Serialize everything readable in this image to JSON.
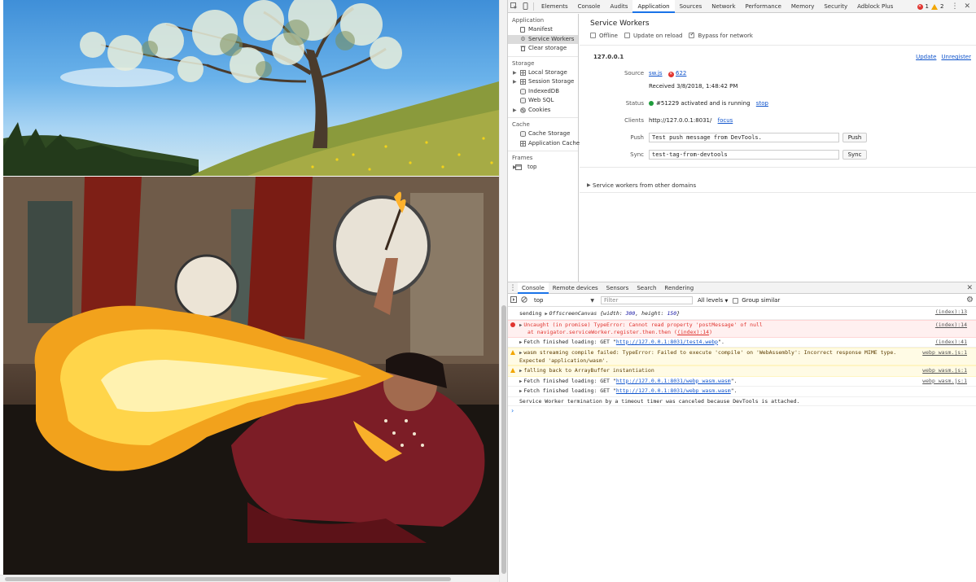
{
  "devtools": {
    "tabs": [
      "Elements",
      "Console",
      "Audits",
      "Application",
      "Sources",
      "Network",
      "Performance",
      "Memory",
      "Security",
      "Adblock Plus"
    ],
    "active_tab": "Application",
    "error_count": "1",
    "warning_count": "2",
    "accent_color": "#1a73e8"
  },
  "sidebar": {
    "application_header": "Application",
    "application_items": [
      "Manifest",
      "Service Workers",
      "Clear storage"
    ],
    "storage_header": "Storage",
    "storage_items": [
      "Local Storage",
      "Session Storage",
      "IndexedDB",
      "Web SQL",
      "Cookies"
    ],
    "cache_header": "Cache",
    "cache_items": [
      "Cache Storage",
      "Application Cache"
    ],
    "frames_header": "Frames",
    "frames_items": [
      "top"
    ]
  },
  "service_workers": {
    "title": "Service Workers",
    "offline_label": "Offline",
    "update_on_reload_label": "Update on reload",
    "bypass_label": "Bypass for network",
    "origin": "127.0.0.1",
    "update_link": "Update",
    "unregister_link": "Unregister",
    "source_label": "Source",
    "source_file": "sw.js",
    "source_errors": "622",
    "received": "Received 3/8/2018, 1:48:42 PM",
    "status_label": "Status",
    "status_text": "#51229 activated and is running",
    "stop_link": "stop",
    "clients_label": "Clients",
    "client_url": "http://127.0.0.1:8031/",
    "focus_link": "focus",
    "push_label": "Push",
    "push_value": "Test push message from DevTools.",
    "push_button": "Push",
    "sync_label": "Sync",
    "sync_value": "test-tag-from-devtools",
    "sync_button": "Sync",
    "other_domains": "Service workers from other domains"
  },
  "drawer": {
    "tabs": [
      "Console",
      "Remote devices",
      "Sensors",
      "Search",
      "Rendering"
    ],
    "active_tab": "Console",
    "context": "top",
    "filter_placeholder": "Filter",
    "levels": "All levels",
    "group_similar": "Group similar"
  },
  "console": {
    "m1_prefix": "sending",
    "m1_obj": "OffscreenCanvas {",
    "m1_width_key": "width: ",
    "m1_width": "300",
    "m1_height_key": ", height: ",
    "m1_height": "150",
    "m1_close": "}",
    "m1_src": "(index):13",
    "m2_line1": "Uncaught (in promise) TypeError: Cannot read property 'postMessage' of null",
    "m2_line2_a": "at navigator.serviceWorker.register.then.then (",
    "m2_line2_link": "(index):14",
    "m2_line2_b": ")",
    "m2_src": "(index):14",
    "m3_prefix": "Fetch finished loading: GET \"",
    "m3_url": "http://127.0.0.1:8031/test4.webp",
    "m3_suffix": "\".",
    "m3_src": "(index):41",
    "m4_line1": "wasm streaming compile failed: TypeError: Failed to execute 'compile' on 'WebAssembly': Incorrect response MIME type.",
    "m4_line2": "Expected 'application/wasm'.",
    "m4_src": "webp_wasm.js:1",
    "m5_text": "falling back to ArrayBuffer instantiation",
    "m5_src": "webp_wasm.js:1",
    "m6_prefix": "Fetch finished loading: GET \"",
    "m6_url": "http://127.0.0.1:8031/webp_wasm.wasm",
    "m6_suffix": "\".",
    "m6_src": "webp_wasm.js:1",
    "m7_prefix": "Fetch finished loading: GET \"",
    "m7_url": "http://127.0.0.1:8031/webp_wasm.wasm",
    "m7_suffix": "\".",
    "m7_src": "webp_wasm.js:1",
    "m8_text": "Service Worker termination by a timeout timer was canceled because DevTools is attached.",
    "prompt": "›"
  }
}
